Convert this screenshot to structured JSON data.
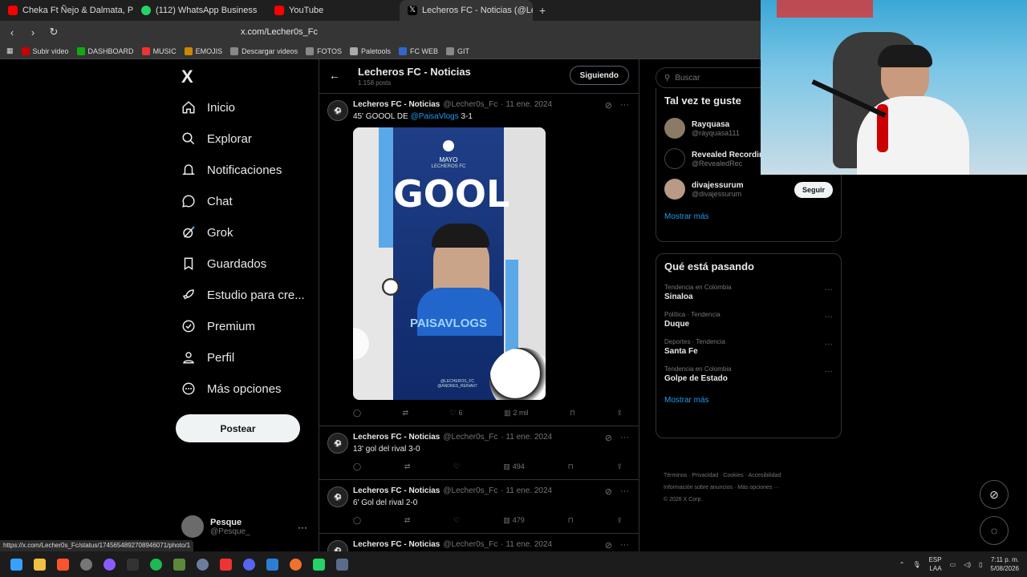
{
  "browser": {
    "tabs": [
      {
        "label": "Cheka Ft Ñejo & Dalmata, Plan B",
        "color": "#ff0000",
        "active": false
      },
      {
        "label": "(112) WhatsApp Business",
        "color": "#25d366",
        "active": false
      },
      {
        "label": "YouTube",
        "color": "#ff0000",
        "active": false
      },
      {
        "label": "Lecheros FC - Noticias (@Lecher0s_Fc)",
        "color": "#ffffff",
        "active": true
      }
    ],
    "url": "x.com/Lecher0s_Fc",
    "bookmarks": [
      "Subir video",
      "DASHBOARD",
      "MUSIC",
      "EMOJIS",
      "Descargar videos",
      "FOTOS",
      "Paletools",
      "FC WEB",
      "GIT"
    ],
    "status_url": "https://x.com/Lecher0s_Fc/status/1745654892708946071/photo/1"
  },
  "nav": {
    "logo": "X",
    "items": [
      {
        "label": "Inicio",
        "icon": "home-icon"
      },
      {
        "label": "Explorar",
        "icon": "search-icon"
      },
      {
        "label": "Notificaciones",
        "icon": "bell-icon"
      },
      {
        "label": "Chat",
        "icon": "chat-icon"
      },
      {
        "label": "Grok",
        "icon": "grok-icon"
      },
      {
        "label": "Guardados",
        "icon": "bookmark-icon"
      },
      {
        "label": "Estudio para cre...",
        "icon": "rocket-icon"
      },
      {
        "label": "Premium",
        "icon": "premium-icon"
      },
      {
        "label": "Perfil",
        "icon": "person-icon"
      },
      {
        "label": "Más opciones",
        "icon": "more-icon"
      }
    ],
    "post_button": "Postear",
    "user": {
      "name": "Pesque",
      "handle": "@Pesque_"
    }
  },
  "profile_header": {
    "title": "Lecheros FC - Noticias",
    "posts": "1.158 posts",
    "follow_label": "Siguiendo"
  },
  "tweets": [
    {
      "name": "Lecheros FC - Noticias",
      "handle": "@Lecher0s_Fc",
      "date": "· 11 ene. 2024",
      "text_pre": "45' GOOOL DE ",
      "mention": "@PaisaVlogs",
      "text_post": " 3-1",
      "media": {
        "top": "MAYO",
        "sub": "LECHEROS FC",
        "headline": "GOOL",
        "player": "PAISAVLOGS",
        "credits": "@LECHEROS_FC @ANDRES_REINA07"
      },
      "likes": "6",
      "views": "2 mil"
    },
    {
      "name": "Lecheros FC - Noticias",
      "handle": "@Lecher0s_Fc",
      "date": "· 11 ene. 2024",
      "text": "13' gol del rival 3-0",
      "views": "494"
    },
    {
      "name": "Lecheros FC - Noticias",
      "handle": "@Lecher0s_Fc",
      "date": "· 11 ene. 2024",
      "text": "6' Gol del rival 2-0",
      "views": "479"
    },
    {
      "name": "Lecheros FC - Noticias",
      "handle": "@Lecher0s_Fc",
      "date": "· 11 ene. 2024"
    }
  ],
  "right": {
    "search_placeholder": "Buscar",
    "who_title": "Tal vez te guste",
    "who": [
      {
        "name": "Rayquasa",
        "handle": "@rayquasa111"
      },
      {
        "name": "Revealed Recordings",
        "handle": "@RevealedRec"
      },
      {
        "name": "divajessurum",
        "handle": "@divajessurum",
        "button": "Seguir"
      }
    ],
    "show_more": "Mostrar más",
    "trends_title": "Qué está pasando",
    "trends": [
      {
        "context": "Tendencia en Colombia",
        "name": "Sinaloa"
      },
      {
        "context": "Política · Tendencia",
        "name": "Duque"
      },
      {
        "context": "Deportes · Tendencia",
        "name": "Santa Fe"
      },
      {
        "context": "Tendencia en Colombia",
        "name": "Golpe de Estado"
      }
    ],
    "footer": [
      "Términos",
      "Privacidad",
      "Cookies",
      "Accesibilidad",
      "Información sobre anuncios",
      "Más opciones ···",
      "© 2026 X Corp."
    ]
  },
  "taskbar": {
    "lang": "ESP",
    "lang2": "LAA",
    "time": "7:11 p. m.",
    "date": "5/08/2026"
  }
}
